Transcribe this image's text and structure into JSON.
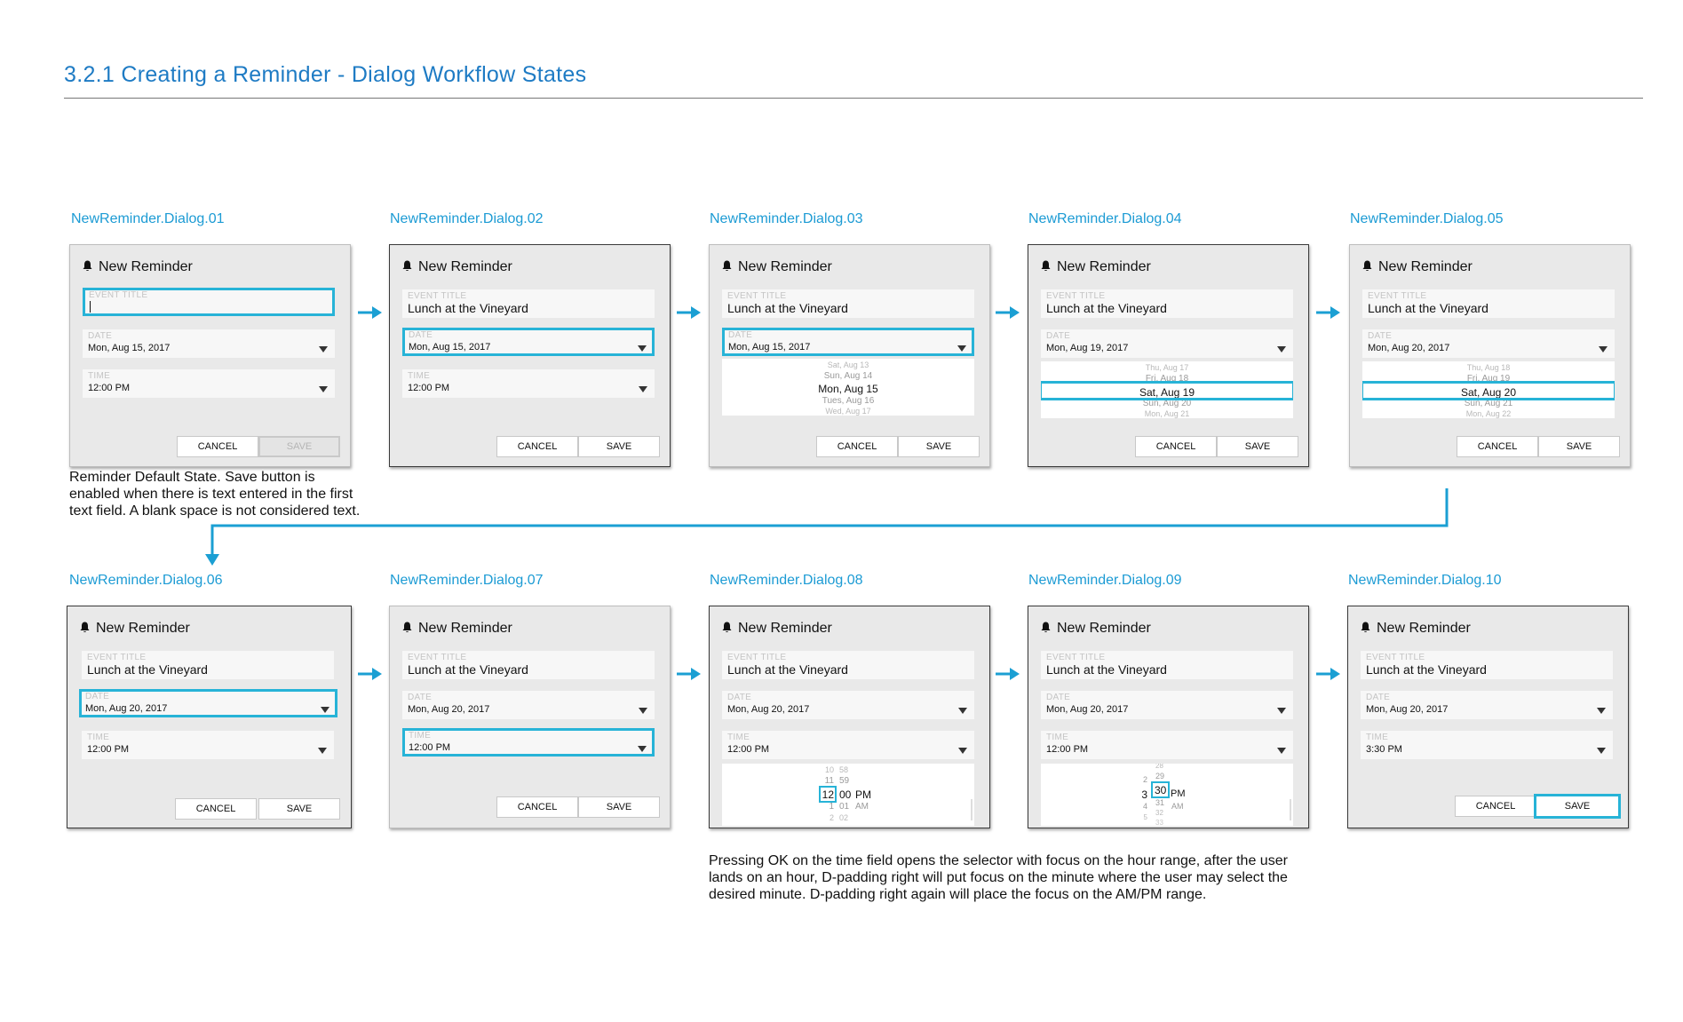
{
  "page_title": "3.2.1  Creating a Reminder - Dialog Workflow States",
  "labels": {
    "d01": "NewReminder.Dialog.01",
    "d02": "NewReminder.Dialog.02",
    "d03": "NewReminder.Dialog.03",
    "d04": "NewReminder.Dialog.04",
    "d05": "NewReminder.Dialog.05",
    "d06": "NewReminder.Dialog.06",
    "d07": "NewReminder.Dialog.07",
    "d08": "NewReminder.Dialog.08",
    "d09": "NewReminder.Dialog.09",
    "d10": "NewReminder.Dialog.10"
  },
  "dialog_title": "New Reminder",
  "field_labels": {
    "event_title": "EVENT TITLE",
    "date": "DATE",
    "time": "TIME"
  },
  "buttons": {
    "cancel": "CANCEL",
    "save": "SAVE"
  },
  "values": {
    "event_title": "Lunch at the Vineyard",
    "date_aug15": "Mon, Aug 15, 2017",
    "date_aug19": "Mon, Aug 19, 2017",
    "date_aug20": "Mon, Aug 20, 2017",
    "time_noon": "12:00 PM",
    "time_330": "3:30 PM"
  },
  "date_picker_03": [
    "Sat, Aug 13",
    "Sun, Aug 14",
    "Mon, Aug 15",
    "Tues, Aug 16",
    "Wed, Aug 17"
  ],
  "date_picker_04": [
    "Thu, Aug 17",
    "Fri, Aug 18",
    "Sat, Aug 19",
    "Sun, Aug 20",
    "Mon, Aug 21"
  ],
  "date_picker_05": [
    "Thu, Aug 18",
    "Fri, Aug 19",
    "Sat, Aug 20",
    "Sun, Aug 21",
    "Mon, Aug 22"
  ],
  "time_picker_08": {
    "hours": [
      "10",
      "11",
      "12",
      "1",
      "2"
    ],
    "minutes": [
      "58",
      "59",
      "00",
      "01",
      "02"
    ],
    "ampm": [
      "PM",
      "AM"
    ]
  },
  "time_picker_09": {
    "hours": [
      "2",
      "3",
      "4",
      "5"
    ],
    "minutes": [
      "28",
      "29",
      "30",
      "31",
      "32",
      "33"
    ],
    "ampm": [
      "PM",
      "AM"
    ]
  },
  "notes": {
    "default_state": [
      "Reminder Default State. Save button is",
      "enabled when there is text entered in the first",
      "text field. A blank space is not considered text."
    ],
    "time_picker": [
      "Pressing OK on the time field opens the selector with focus on the hour range, after the user",
      "lands on an hour, D-padding right will put focus on the minute where the user may select the",
      "desired minute. D-padding right again will place the focus on the AM/PM range."
    ]
  },
  "colors": {
    "accent": "#27b3d7",
    "title": "#1e7bc4",
    "label": "#1c9bd4",
    "arrow": "#1b9fd3"
  }
}
